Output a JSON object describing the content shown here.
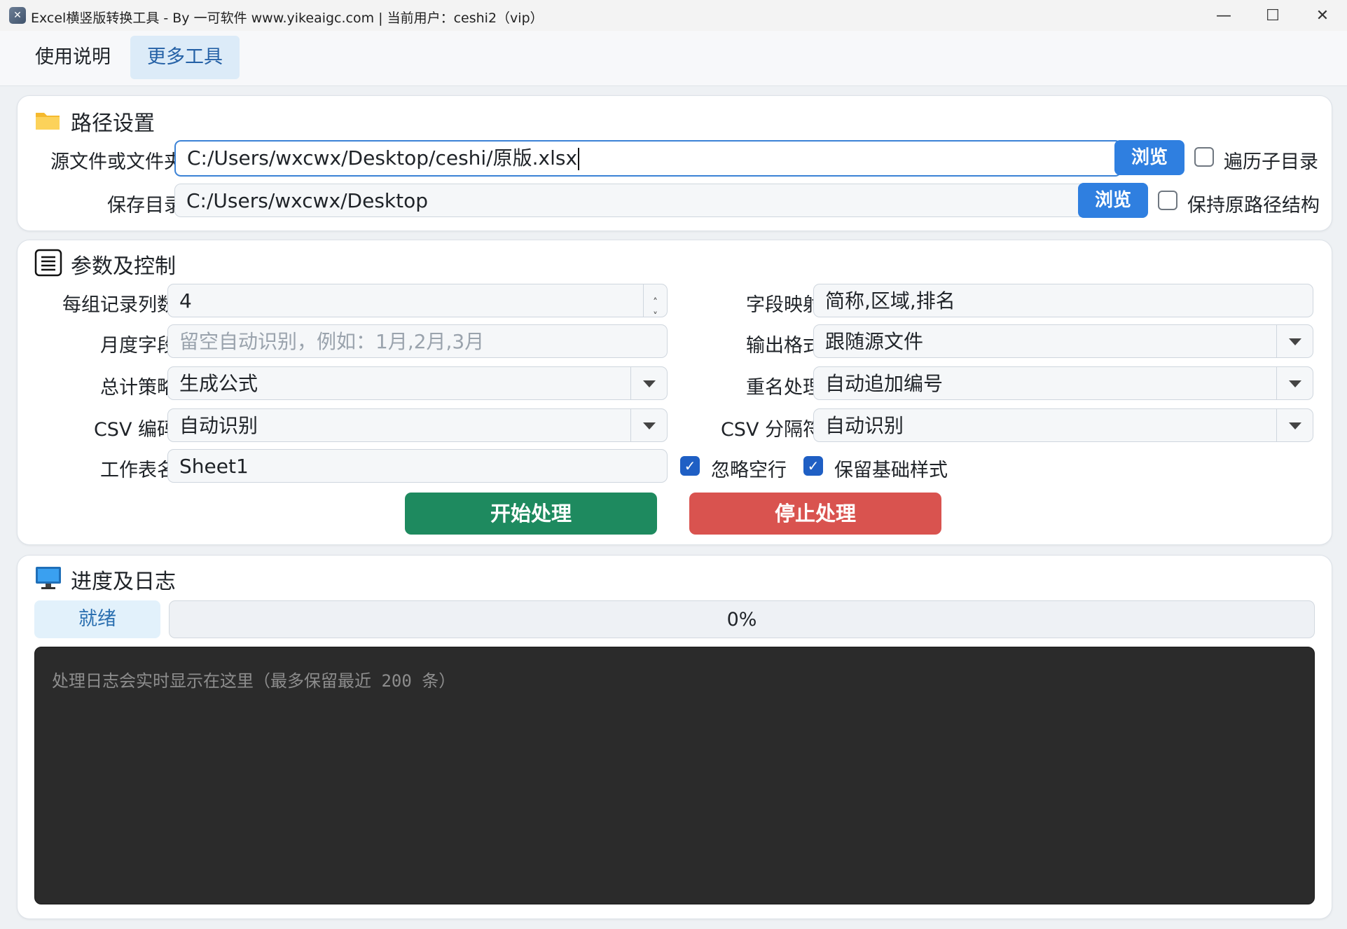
{
  "window": {
    "title": "Excel横竖版转换工具 - By 一可软件 www.yikeaigc.com | 当前用户：ceshi2（vip）",
    "minimize": "—",
    "maximize": "☐",
    "close": "✕"
  },
  "menu": {
    "items": [
      {
        "label": "使用说明"
      },
      {
        "label": "更多工具"
      }
    ]
  },
  "path_section": {
    "title": "路径设置",
    "source_label": "源文件或文件夹",
    "source_value": "C:/Users/wxcwx/Desktop/ceshi/原版.xlsx",
    "browse_label": "浏览",
    "traverse_label": "遍历子目录",
    "traverse_checked": false,
    "save_label": "保存目录",
    "save_value": "C:/Users/wxcwx/Desktop",
    "browse2_label": "浏览",
    "keep_structure_label": "保持原路径结构",
    "keep_structure_checked": false
  },
  "params_section": {
    "title": "参数及控制",
    "records_label": "每组记录列数",
    "records_value": "4",
    "month_label": "月度字段",
    "month_placeholder": "留空自动识别，例如：1月,2月,3月",
    "total_label": "总计策略",
    "total_value": "生成公式",
    "csv_enc_label": "CSV 编码",
    "csv_enc_value": "自动识别",
    "sheet_label": "工作表名",
    "sheet_value": "Sheet1",
    "field_map_label": "字段映射",
    "field_map_value": "简称,区域,排名",
    "out_fmt_label": "输出格式",
    "out_fmt_value": "跟随源文件",
    "rename_label": "重名处理",
    "rename_value": "自动追加编号",
    "csv_sep_label": "CSV 分隔符",
    "csv_sep_value": "自动识别",
    "ignore_empty_label": "忽略空行",
    "ignore_empty_checked": true,
    "keep_style_label": "保留基础样式",
    "keep_style_checked": true,
    "start_label": "开始处理",
    "stop_label": "停止处理"
  },
  "progress_section": {
    "title": "进度及日志",
    "status": "就绪",
    "progress_text": "0%",
    "progress_value": 0,
    "log_placeholder": "处理日志会实时显示在这里（最多保留最近 200 条）"
  },
  "colors": {
    "accent": "#2f7fe0",
    "start": "#1e8a5f",
    "stop": "#d9534f",
    "log_bg": "#2b2b2b"
  }
}
